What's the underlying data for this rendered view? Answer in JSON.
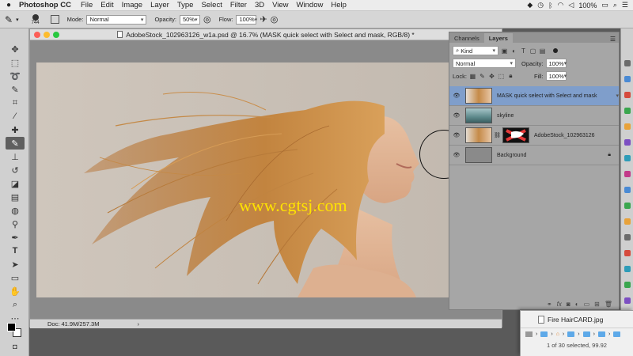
{
  "menubar": {
    "app_name": "Photoshop CC",
    "items": [
      "File",
      "Edit",
      "Image",
      "Layer",
      "Type",
      "Select",
      "Filter",
      "3D",
      "View",
      "Window",
      "Help"
    ],
    "battery": "100%",
    "status_icons": [
      "dropbox-icon",
      "clock-icon",
      "bluetooth-icon",
      "wifi-icon",
      "volume-icon",
      "battery-icon"
    ]
  },
  "options": {
    "brush_size": "744",
    "mode_label": "Mode:",
    "mode_value": "Normal",
    "opacity_label": "Opacity:",
    "opacity_value": "50%",
    "flow_label": "Flow:",
    "flow_value": "100%"
  },
  "document": {
    "title": "AdobeStock_102963126_w1a.psd @ 16.7% (MASK quick select with Select and mask, RGB/8) *",
    "status": "Doc: 41.9M/257.3M",
    "watermark": "www.cgtsj.com"
  },
  "panel": {
    "tabs": [
      "Channels",
      "Layers"
    ],
    "kind_label": "Kind",
    "blend_mode": "Normal",
    "opacity_label": "Opacity:",
    "opacity_value": "100%",
    "lock_label": "Lock:",
    "fill_label": "Fill:",
    "fill_value": "100%",
    "layers": [
      {
        "name": "MASK quick select with Select and mask",
        "selected": true
      },
      {
        "name": "skyline",
        "selected": false
      },
      {
        "name": "AdobeStock_102963126",
        "selected": false
      },
      {
        "name": "Background",
        "selected": false
      }
    ]
  },
  "finder": {
    "file_name": "Fire HairCARD.jpg",
    "selection_info": "1 of 30 selected, 99.92"
  },
  "colors": {
    "accent_selected_layer": "#7f9ecb",
    "watermark": "#ffe400",
    "background_photo": "#c9c0b6"
  }
}
